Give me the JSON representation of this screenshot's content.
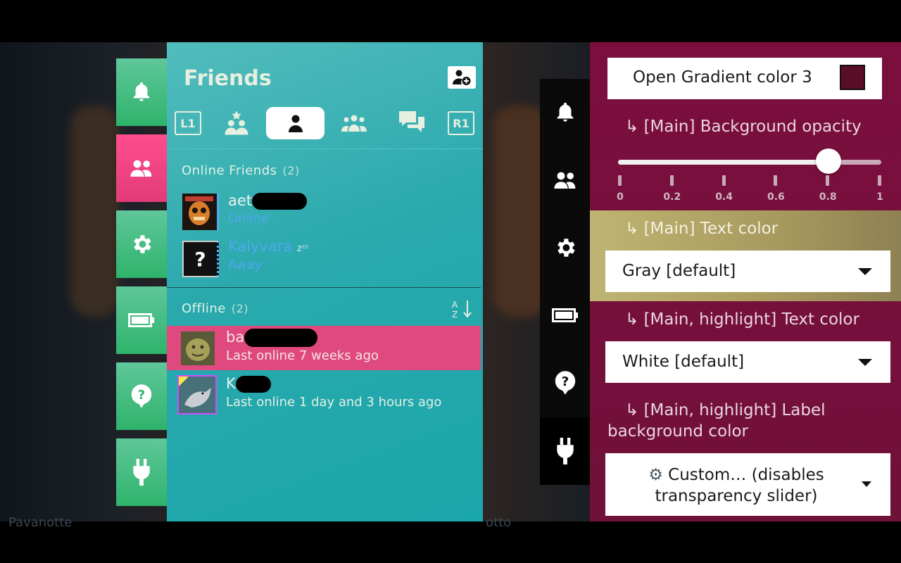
{
  "friends_panel": {
    "title": "Friends",
    "tabs": {
      "left_shoulder": "L1",
      "right_shoulder": "R1"
    },
    "online_section": {
      "label": "Online Friends",
      "count": "(2)"
    },
    "online": [
      {
        "name": "aet",
        "status": "Online"
      },
      {
        "name": "Kalyvara",
        "away_marker": "zᶻᶻ",
        "status": "Away"
      }
    ],
    "offline_section": {
      "label": "Offline",
      "count": "(2)"
    },
    "offline": [
      {
        "name": "ba",
        "status": "Last online 7 weeks ago"
      },
      {
        "name": "K",
        "status": "Last online 1 day and 3 hours ago"
      }
    ],
    "unknown_avatar_glyph": "?"
  },
  "settings_panel": {
    "gradient_button_label": "Open Gradient color 3",
    "gradient_swatch_color": "#5a0d26",
    "opacity_label": "↳ [Main] Background opacity",
    "opacity_value": 0.8,
    "opacity_ticks": [
      "0",
      "0.2",
      "0.4",
      "0.6",
      "0.8",
      "1"
    ],
    "text_color_label": "↳ [Main] Text color",
    "text_color_value": "Gray [default]",
    "highlight_text_color_label": "↳ [Main, highlight] Text color",
    "highlight_text_color_value": "White [default]",
    "highlight_label_bg_label_line1": "↳ [Main, highlight] Label",
    "highlight_label_bg_label_line2": "background color",
    "highlight_label_bg_value_line1": "Custom… (disables",
    "highlight_label_bg_value_line2": "transparency slider)"
  },
  "background_text": {
    "game_title_left": "Pavanotte",
    "game_title_right": "otto"
  },
  "colors": {
    "accent_pink": "#e13c78",
    "rail_green": "#2fb36b",
    "friends_teal": "#2aa9ad",
    "settings_maroon": "#7b0e3d",
    "highlight_row": "#bfb473",
    "status_online": "#4ea8f0"
  },
  "icons": {
    "left_rail": [
      "bell-icon",
      "friends-icon",
      "gear-icon",
      "battery-icon",
      "help-icon",
      "plug-icon"
    ],
    "right_rail": [
      "bell-icon",
      "friends-icon",
      "gear-icon",
      "battery-icon",
      "help-icon",
      "plug-icon"
    ]
  }
}
